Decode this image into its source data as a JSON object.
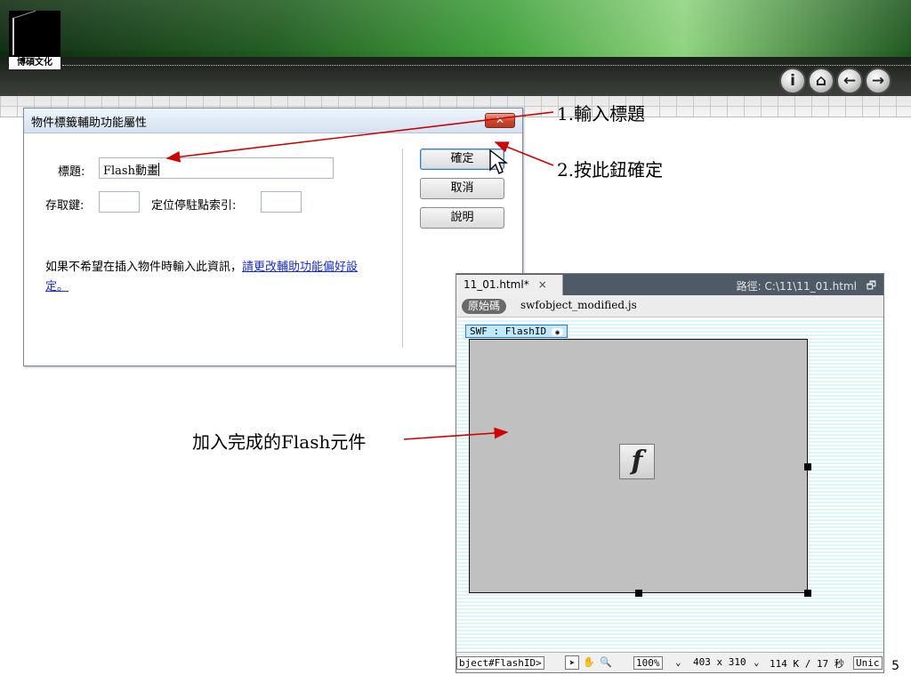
{
  "slide": {
    "logo_text": "博碩文化",
    "nav_buttons": [
      {
        "icon": "info-icon",
        "glyph": "i"
      },
      {
        "icon": "home-icon",
        "glyph": "⌂"
      },
      {
        "icon": "back-arrow-icon",
        "glyph": "←"
      },
      {
        "icon": "forward-arrow-icon",
        "glyph": "→"
      }
    ],
    "page_number": "5"
  },
  "dialog": {
    "title": "物件標籤輔助功能屬性",
    "close_glyph": "✕",
    "title_label": "標題:",
    "title_value": "Flash動畫",
    "access_key_label": "存取鍵:",
    "access_key_value": "",
    "tab_index_label": "定位停駐點索引:",
    "tab_index_value": "",
    "ok_label": "確定",
    "cancel_label": "取消",
    "help_label": "說明",
    "note_text": "如果不希望在插入物件時輸入此資訊，",
    "note_link": "請更改輔助功能偏好設定。"
  },
  "annotations": {
    "step1": "1.輸入標題",
    "step2": "2.按此鈕確定",
    "result": "加入完成的Flash元件"
  },
  "dreamweaver": {
    "tab_name": "11_01.html*",
    "tab_close": "×",
    "path_text": "路徑: C:\\11\\11_01.html",
    "restore_glyph": "🗗",
    "source_pill": "原始碼",
    "related_file": "swfobject_modified.js",
    "swf_tag": "SWF : FlashID",
    "flash_glyph": "f",
    "status": {
      "tag_selector": "bject#FlashID>",
      "zoom": "100%",
      "dimensions": "403 x 310",
      "size_time": "114 K / 17 秒",
      "encoding": "Unic"
    }
  }
}
